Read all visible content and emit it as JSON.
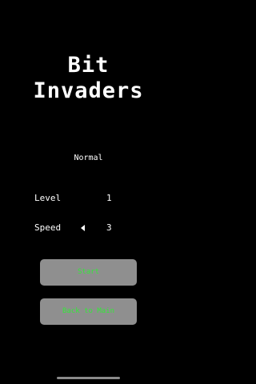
{
  "title": {
    "line1": "Bit",
    "line2": "Invaders"
  },
  "difficulty": {
    "label": "Normal"
  },
  "settings": {
    "level": {
      "label": "Level",
      "value": "1"
    },
    "speed": {
      "label": "Speed",
      "value": "3",
      "decrease_icon": "left-triangle-icon"
    }
  },
  "buttons": {
    "start_label": "Start",
    "back_label": "Back to Main"
  },
  "colors": {
    "background": "#000000",
    "text": "#ffffff",
    "button_bg": "#8f8f8f",
    "button_text": "#35e83a"
  }
}
